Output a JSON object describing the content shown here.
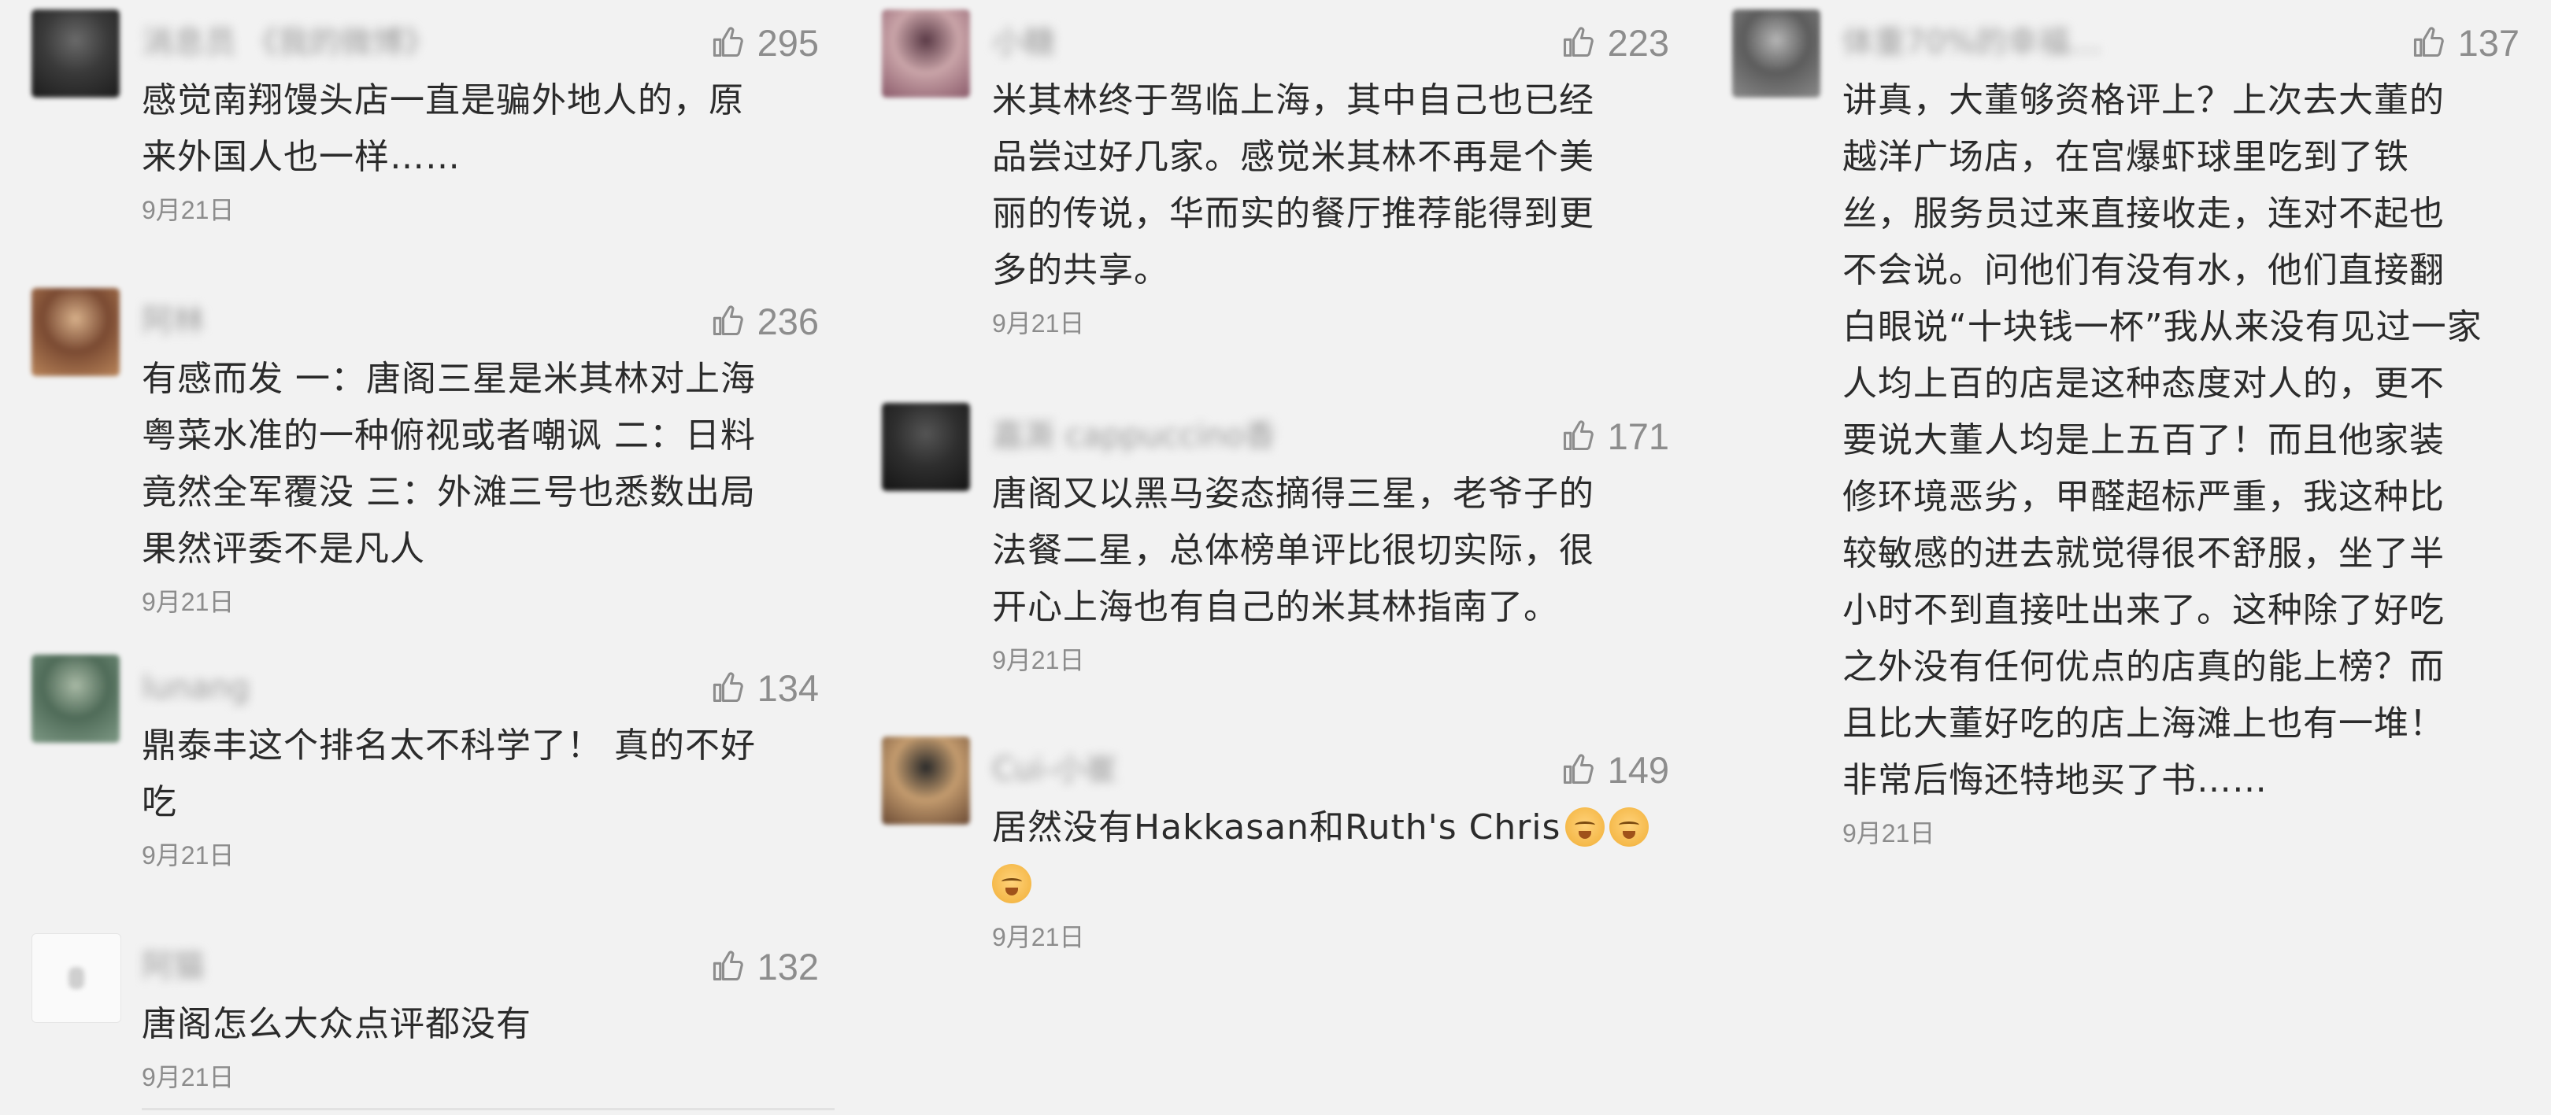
{
  "columns": [
    {
      "comments": [
        {
          "username": "消息员 《我的微博》",
          "likes": "295",
          "lines": [
            "感觉南翔馒头店一直是骗外地人的，原",
            "来外国人也一样……"
          ],
          "date": "9月21日",
          "avatar_colors": [
            "#1c1c1c",
            "#3a3a3a",
            "#6a6a6a"
          ]
        },
        {
          "username": "阿林",
          "likes": "236",
          "lines": [
            "有感而发 一：唐阁三星是米其林对上海",
            "粤菜水准的一种俯视或者嘲讽  二：日料",
            "竟然全军覆没 三：外滩三号也悉数出局",
            "果然评委不是凡人"
          ],
          "date": "9月21日",
          "avatar_colors": [
            "#b9855a",
            "#7a4a32",
            "#d7b08a"
          ]
        },
        {
          "username": "lunang",
          "likes": "134",
          "lines": [
            "鼎泰丰这个排名太不科学了！ 真的不好",
            "吃"
          ],
          "date": "9月21日",
          "avatar_colors": [
            "#7f9a86",
            "#4f6b58",
            "#a8b9a5"
          ]
        },
        {
          "username": "阿猫",
          "likes": "132",
          "lines": [
            "唐阁怎么大众点评都没有"
          ],
          "date": "9月21日",
          "avatar_colors": [
            "#fafafa",
            "#e8e8e8",
            "#d0d0d0"
          ]
        }
      ]
    },
    {
      "comments": [
        {
          "username": "小糖",
          "likes": "223",
          "lines": [
            "米其林终于驾临上海，其中自己也已经",
            "品尝过好几家。感觉米其林不再是个美",
            "丽的传说，华而实的餐厅推荐能得到更",
            "多的共享。"
          ],
          "date": "9月21日",
          "avatar_colors": [
            "#8a5a6a",
            "#c9a4a8",
            "#5a3a46"
          ]
        },
        {
          "username": "嘉澌 cappuccino香",
          "likes": "171",
          "lines": [
            "唐阁又以黑马姿态摘得三星，老爷子的",
            "法餐二星，总体榜单评比很切实际，很",
            "开心上海也有自己的米其林指南了。"
          ],
          "date": "9月21日",
          "avatar_colors": [
            "#141414",
            "#2e2e2e",
            "#555555"
          ]
        },
        {
          "username": "Cui-小崔",
          "likes": "149",
          "lines": [
            "居然没有Hakkasan和Ruth's Chris"
          ],
          "emoji_line1": [
            "grin-squint-emoji",
            "grin-squint-emoji"
          ],
          "emoji_line2": [
            "grin-squint-emoji"
          ],
          "date": "9月21日",
          "avatar_colors": [
            "#6a4a34",
            "#c39b6e",
            "#2a2a2a"
          ]
        }
      ]
    },
    {
      "comments": [
        {
          "username": "体重70%的幸福…",
          "likes": "137",
          "lines": [
            "讲真，大董够资格评上？上次去大董的",
            "越洋广场店，在宫爆虾球里吃到了铁",
            "丝，服务员过来直接收走，连对不起也",
            "不会说。问他们有没有水，他们直接翻",
            "白眼说“十块钱一杯”我从来没有见过一家",
            "人均上百的店是这种态度对人的，更不",
            "要说大董人均是上五百了！而且他家装",
            "修环境恶劣，甲醛超标严重，我这种比",
            "较敏感的进去就觉得很不舒服，坐了半",
            "小时不到直接吐出来了。这种除了好吃",
            "之外没有任何优点的店真的能上榜？而",
            "且比大董好吃的店上海滩上也有一堆！",
            "非常后悔还特地买了书……"
          ],
          "date": "9月21日",
          "avatar_colors": [
            "#8a8a8a",
            "#5c5c5c",
            "#b5b5b5"
          ]
        }
      ]
    }
  ]
}
